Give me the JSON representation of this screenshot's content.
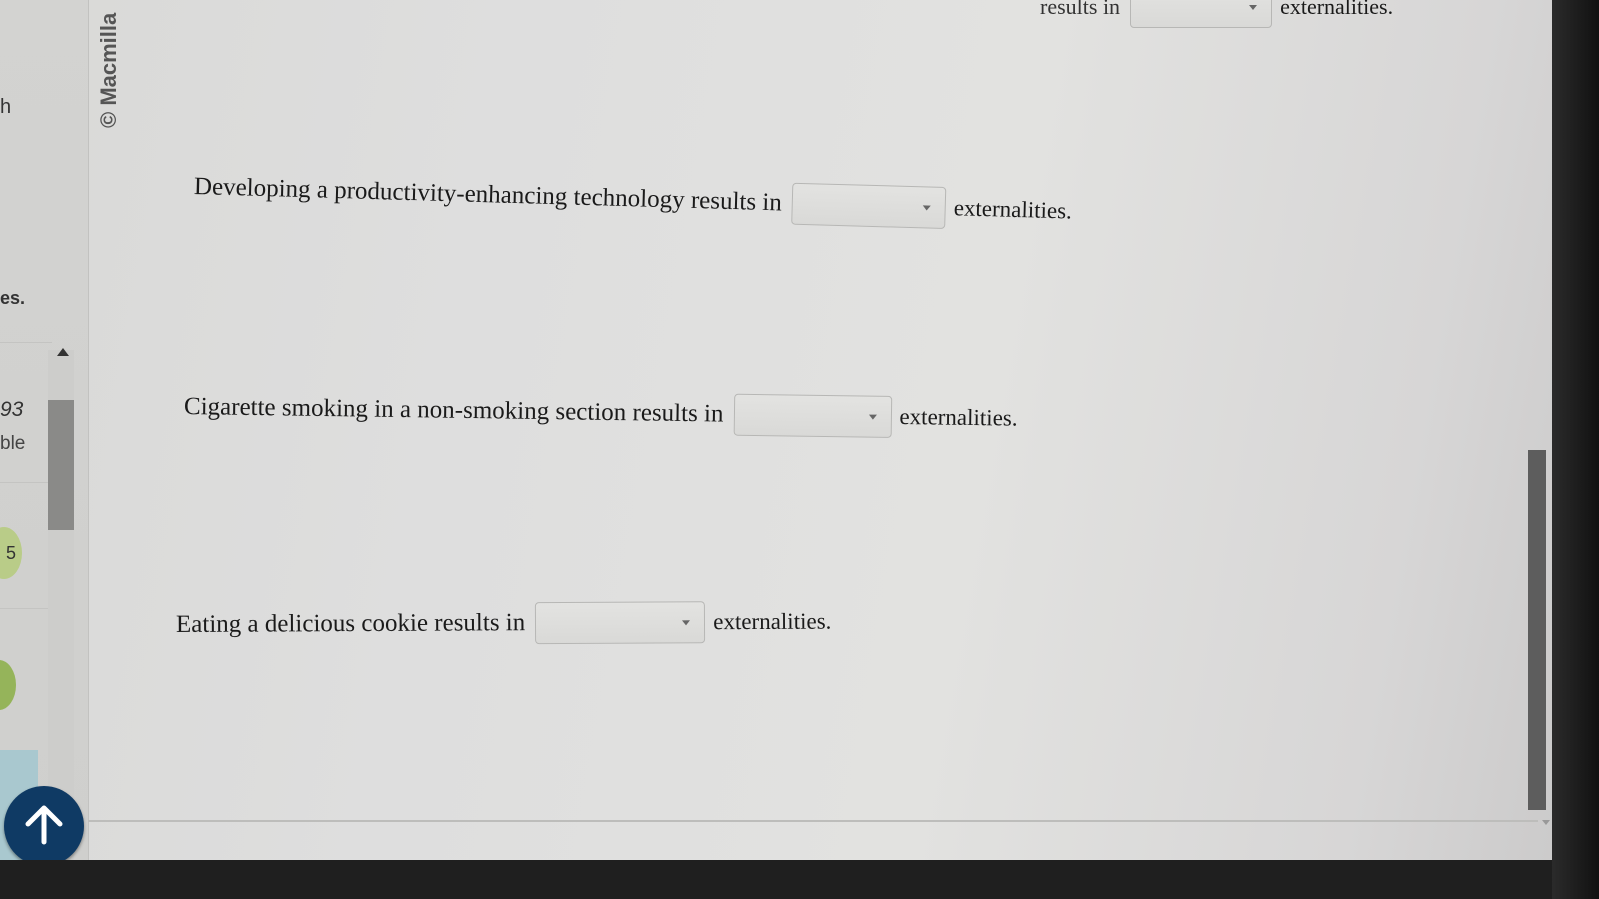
{
  "left_panel": {
    "fragment_h": "h",
    "fragment_es": "es.",
    "fragment_93": "93",
    "fragment_ble": "ble",
    "badge_5": "5"
  },
  "copyright": "© Macmilla",
  "questions": [
    {
      "text": "results in",
      "suffix": "externalities."
    },
    {
      "text": "Developing a productivity-enhancing technology results in",
      "suffix": "externalities."
    },
    {
      "text": "Cigarette smoking in a non-smoking section results in",
      "suffix": "externalities."
    },
    {
      "text": "Eating a delicious cookie results in",
      "suffix": "externalities."
    }
  ],
  "colors": {
    "scroll_top_button": "#0f3a64",
    "badge_green": "#95b45a"
  },
  "icons": {
    "scroll_top": "arrow-up-icon",
    "dropdown": "caret-down-icon"
  }
}
